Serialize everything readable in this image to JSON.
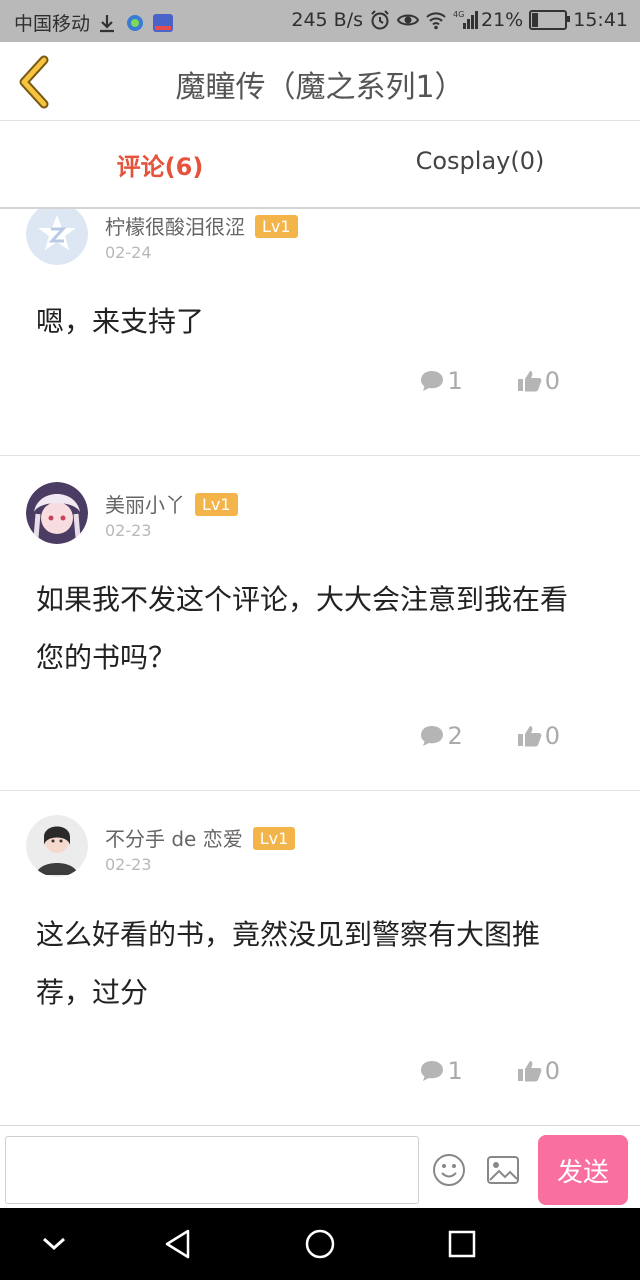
{
  "status_bar": {
    "carrier": "中国移动",
    "network_speed": "245 B/s",
    "network_type": "4G",
    "battery_percent": "21%",
    "battery_level": 0.21,
    "time": "15:41"
  },
  "header": {
    "title": "魔瞳传（魔之系列1）",
    "back_icon": "chevron-left-icon"
  },
  "tabs": [
    {
      "label": "评论(6)",
      "active": true
    },
    {
      "label": "Cosplay(0)",
      "active": false
    }
  ],
  "comments": [
    {
      "username": "柠檬很酸泪很涩",
      "level": "Lv1",
      "date": "02-24",
      "content": "嗯，来支持了",
      "reply_count": "1",
      "like_count": "0"
    },
    {
      "username": "美丽小丫",
      "level": "Lv1",
      "date": "02-23",
      "content": "如果我不发这个评论，大大会注意到我在看您的书吗？",
      "reply_count": "2",
      "like_count": "0"
    },
    {
      "username": "不分手 de 恋爱",
      "level": "Lv1",
      "date": "02-23",
      "content": "这么好看的书，竟然没见到警察有大图推荐，过分",
      "reply_count": "1",
      "like_count": "0"
    }
  ],
  "input_bar": {
    "placeholder": "",
    "send_label": "发送",
    "emoji_icon": "smiley-icon",
    "image_icon": "image-icon"
  },
  "colors": {
    "accent": "#e5533c",
    "send_button": "#f86fa0",
    "level_badge": "#f3b54a"
  }
}
